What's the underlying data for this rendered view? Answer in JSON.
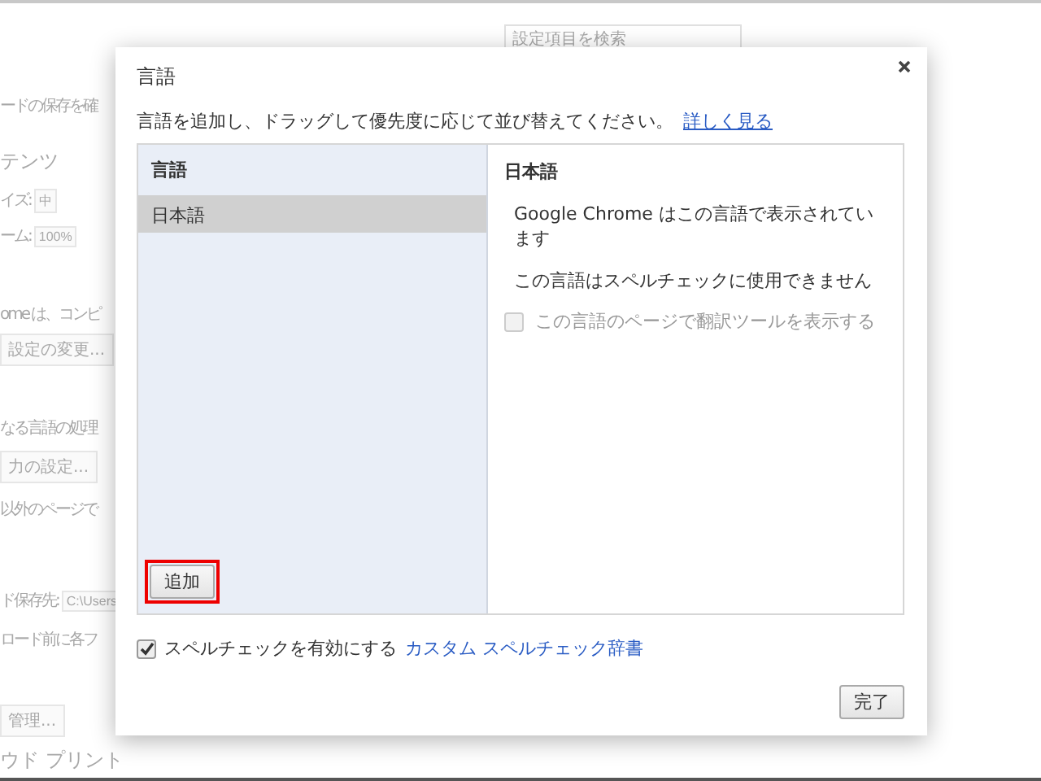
{
  "background_page": {
    "search": {
      "placeholder": "設定項目を検索"
    },
    "rows": [
      {
        "kind": "text",
        "text": "ードの保存を確"
      },
      {
        "kind": "heading",
        "text": "テンツ"
      },
      {
        "kind": "field",
        "text": "イズ:",
        "value": "中"
      },
      {
        "kind": "field",
        "text": "ーム:",
        "value": "100%"
      },
      {
        "kind": "text",
        "text": "ome は、コンピ"
      },
      {
        "kind": "button",
        "text": "設定の変更..."
      },
      {
        "kind": "text",
        "text": "なる言語の処理"
      },
      {
        "kind": "button",
        "text": "力の設定..."
      },
      {
        "kind": "text",
        "text": "以外のページで"
      },
      {
        "kind": "field",
        "text": "ド保存先:",
        "value": "C:\\Users"
      },
      {
        "kind": "text",
        "text": "ロード前に各フ"
      },
      {
        "kind": "button",
        "text": "管理..."
      },
      {
        "kind": "heading",
        "text": "ウド プリント"
      }
    ]
  },
  "dialog": {
    "title": "言語",
    "description": "言語を追加し、ドラッグして優先度に応じて並び替えてください。",
    "learn_more_link": "詳しく見る",
    "language_list": {
      "header": "言語",
      "items": [
        {
          "label": "日本語",
          "selected": true
        }
      ],
      "add_button": "追加"
    },
    "details": {
      "title": "日本語",
      "lines": [
        "Google Chrome はこの言語で表示されています",
        "この言語はスペルチェックに使用できません"
      ],
      "translate_checkbox": {
        "label": "この言語のページで翻訳ツールを表示する",
        "checked": false,
        "disabled": true
      }
    },
    "spellcheck": {
      "label": "スペルチェックを有効にする",
      "checked": true,
      "link": "カスタム スペルチェック辞書"
    },
    "done_button": "完了"
  }
}
